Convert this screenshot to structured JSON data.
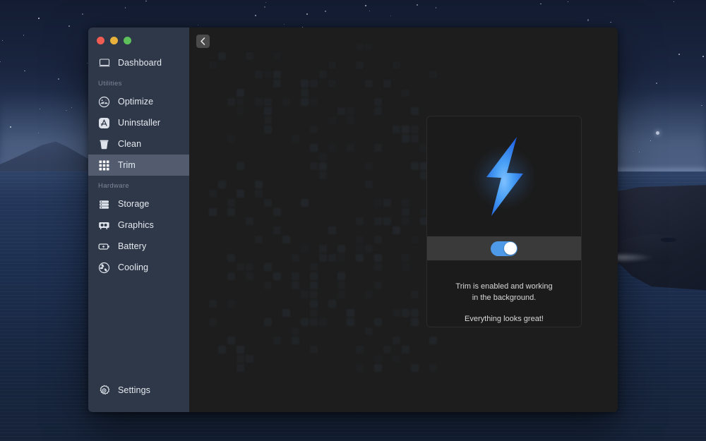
{
  "window": {
    "traffic_lights": [
      {
        "name": "close",
        "color": "#f05b52"
      },
      {
        "name": "minimize",
        "color": "#e7b13c"
      },
      {
        "name": "zoom",
        "color": "#5ec05a"
      }
    ]
  },
  "sidebar": {
    "top_items": [
      {
        "id": "dashboard",
        "label": "Dashboard",
        "icon": "monitor-icon",
        "active": false
      }
    ],
    "sections": [
      {
        "label": "Utilities",
        "items": [
          {
            "id": "optimize",
            "label": "Optimize",
            "icon": "speedometer-icon",
            "active": false
          },
          {
            "id": "uninstaller",
            "label": "Uninstaller",
            "icon": "appstore-icon",
            "active": false
          },
          {
            "id": "clean",
            "label": "Clean",
            "icon": "trash-icon",
            "active": false
          },
          {
            "id": "trim",
            "label": "Trim",
            "icon": "grid-icon",
            "active": true
          }
        ]
      },
      {
        "label": "Hardware",
        "items": [
          {
            "id": "storage",
            "label": "Storage",
            "icon": "drive-stack-icon",
            "active": false
          },
          {
            "id": "graphics",
            "label": "Graphics",
            "icon": "gpu-card-icon",
            "active": false
          },
          {
            "id": "battery",
            "label": "Battery",
            "icon": "battery-bolt-icon",
            "active": false
          },
          {
            "id": "cooling",
            "label": "Cooling",
            "icon": "fan-icon",
            "active": false
          }
        ]
      }
    ],
    "footer": {
      "id": "settings",
      "label": "Settings",
      "icon": "gear-icon"
    },
    "colors": {
      "background": "#2f3848",
      "active_background": "#525c6e",
      "label": "#e6eaf1",
      "section_label": "#7c879b"
    }
  },
  "content": {
    "back_button": {
      "name": "back-button",
      "icon": "chevron-left-icon"
    },
    "background": "#1d1d1d"
  },
  "card": {
    "icon": "lightning-bolt-icon",
    "toggle": {
      "name": "trim-toggle",
      "state": "on",
      "on_color": "#4e9ae8",
      "knob_color": "#ffffff"
    },
    "status_line1": "Trim is enabled and working",
    "status_line2": "in the background.",
    "status_extra": "Everything looks great!",
    "colors": {
      "card_background": "#1b1b1b",
      "band_background": "#3a3a3a",
      "text": "#d8d8d8"
    }
  }
}
